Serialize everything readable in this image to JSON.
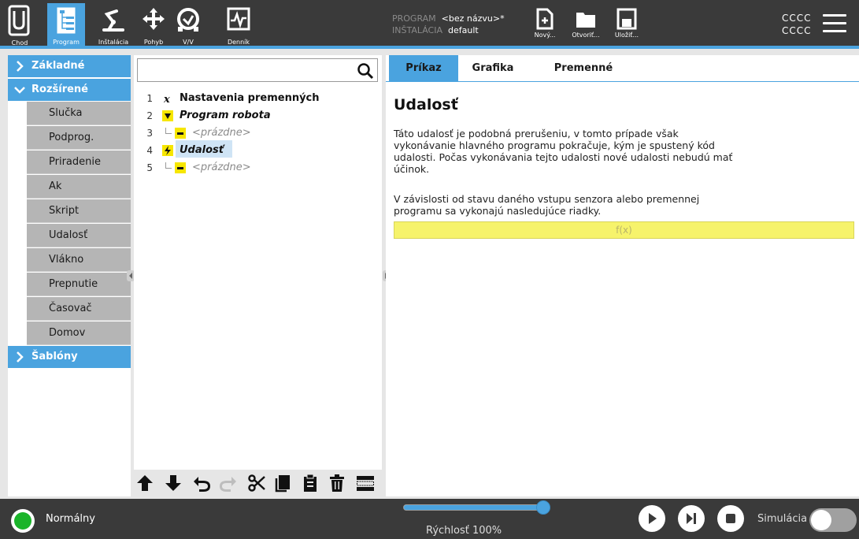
{
  "topbar": {
    "nav": [
      {
        "id": "run",
        "label": "Chod"
      },
      {
        "id": "program",
        "label": "Program",
        "active": true
      },
      {
        "id": "installation",
        "label": "Inštalácia"
      },
      {
        "id": "move",
        "label": "Pohyb"
      },
      {
        "id": "io",
        "label": "V/V"
      },
      {
        "id": "log",
        "label": "Denník"
      }
    ],
    "program_key": "PROGRAM",
    "program_value": "<bez názvu>*",
    "installation_key": "INŠTALÁCIA",
    "installation_value": "default",
    "file_buttons": [
      {
        "id": "new",
        "label": "Nový..."
      },
      {
        "id": "open",
        "label": "Otvoriť..."
      },
      {
        "id": "save",
        "label": "Uložiť..."
      }
    ],
    "right_text_1": "CCCC",
    "right_text_2": "CCCC"
  },
  "left_panel": {
    "basic_label": "Základné",
    "advanced_label": "Rozšírené",
    "advanced_items": [
      "Slučka",
      "Podprog.",
      "Priradenie",
      "Ak",
      "Skript",
      "Udalosť",
      "Vlákno",
      "Prepnutie",
      "Časovač",
      "Domov"
    ],
    "templates_label": "Šablóny"
  },
  "search": {
    "placeholder": ""
  },
  "tree": [
    {
      "num": "1",
      "text": "Nastavenia premenných",
      "icon": "variable-x-icon"
    },
    {
      "num": "2",
      "text": "Program robota",
      "icon": "triangle-down-icon"
    },
    {
      "num": "3",
      "text": "<prázdne>",
      "icon": "empty-dash-icon"
    },
    {
      "num": "4",
      "text": "Udalosť",
      "icon": "lightning-icon",
      "selected": true
    },
    {
      "num": "5",
      "text": "<prázdne>",
      "icon": "empty-dash-icon"
    }
  ],
  "toolbar_icons": [
    "move-up-icon",
    "move-down-icon",
    "undo-icon",
    "redo-icon",
    "cut-icon",
    "copy-icon",
    "paste-icon",
    "delete-icon",
    "suppress-icon"
  ],
  "right_panel": {
    "tabs": [
      "Príkaz",
      "Grafika",
      "Premenné"
    ],
    "active_tab": "Príkaz",
    "title": "Udalosť",
    "desc1_line1": "Táto udalosť je podobná prerušeniu, v tomto prípade však",
    "desc1_line2": "vykonávanie hlavného programu pokračuje, kým je spustený kód",
    "desc1_line3": "udalosti. Počas vykonávania tejto udalosti nové udalosti nebudú mať",
    "desc1_line4": "účinok.",
    "desc2_line1": "V závislosti od stavu daného vstupu senzora alebo premennej",
    "desc2_line2": "programu sa vykonajú nasledujúce riadky.",
    "fx_label": "f(x)"
  },
  "bottombar": {
    "status": "Normálny",
    "status_color": "#1ab42a",
    "speed_label": "Rýchlosť 100%",
    "speed_fraction": 1.0,
    "sim_label": "Simulácia",
    "sim_on": false
  },
  "colors": {
    "accent": "#4aa3df",
    "topbar": "#3a3a3a",
    "fx_yellow": "#f6f36b"
  }
}
